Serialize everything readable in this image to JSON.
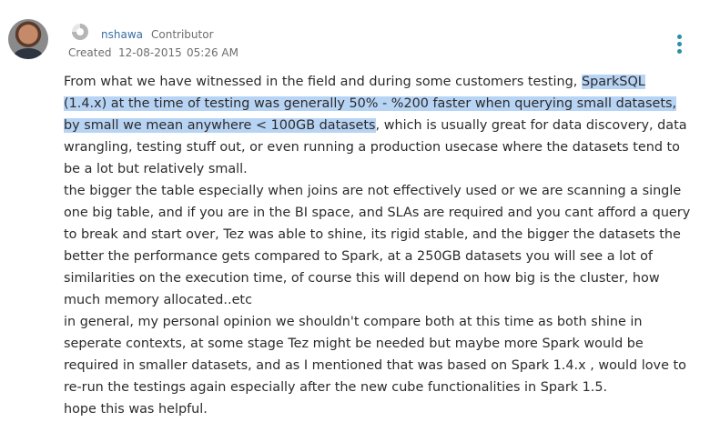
{
  "post": {
    "author": "nshawa",
    "role": "Contributor",
    "created_label": "Created",
    "created_date": "12-08-2015",
    "created_time": "05:26 AM"
  },
  "body": {
    "p1_before": "From what we have witnessed in the field and during some customers testing, ",
    "p1_highlight": "SparkSQL (1.4.x) at the time of testing was generally 50% - %200 faster when querying small datasets, by small we mean anywhere < 100GB datasets",
    "p1_after": ", which is usually great for data discovery, data wrangling, testing stuff out, or even running a production usecase where the datasets tend to be a lot but relatively small.",
    "p2": "the bigger the table especially when joins are not effectively used or we are scanning a single one big table, and if you are in the BI space, and SLAs are required and you cant afford a query to break and start over, Tez was able to shine, its rigid stable, and the bigger the datasets the better the performance gets compared to Spark, at a 250GB datasets you will see a lot of similarities on the execution time, of course this will depend on how big is the cluster, how much memory allocated..etc",
    "p3": "in general, my personal opinion we shouldn't compare both at this time as both shine in seperate contexts, at some stage Tez might be needed but maybe more Spark would be required in smaller datasets, and as I mentioned that was based on Spark 1.4.x , would love to re-run the testings again especially after the new cube functionalities in Spark 1.5.",
    "p4": "hope this was helpful."
  },
  "icons": {
    "avatar": "user-avatar-photo",
    "badge": "rank-badge-icon",
    "menu": "kebab-menu-icon"
  },
  "colors": {
    "username": "#3a6ea5",
    "menu": "#2a8fa6",
    "highlight": "#b8d4f5",
    "meta": "#6d6d6d"
  }
}
